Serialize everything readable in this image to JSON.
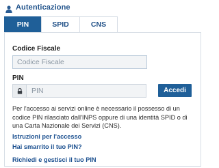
{
  "header": {
    "title": "Autenticazione",
    "icon": "user-icon"
  },
  "tabs": [
    {
      "label": "PIN",
      "active": true
    },
    {
      "label": "SPID",
      "active": false
    },
    {
      "label": "CNS",
      "active": false
    }
  ],
  "form": {
    "codice_fiscale_label": "Codice Fiscale",
    "codice_fiscale_placeholder": "Codice Fiscale",
    "pin_label": "PIN",
    "pin_placeholder": "PIN",
    "lock_icon": "lock-icon",
    "submit_label": "Accedi"
  },
  "info_text": "Per l'accesso ai servizi online è necessario il possesso di un codice PIN rilasciato dall'INPS oppure di una identità SPID o di una Carta Nazionale dei Servizi (CNS).",
  "links": [
    "Istruzioni per l'accesso",
    "Hai smarrito il tuo PIN?",
    "Richiedi e gestisci il tuo PIN"
  ],
  "colors": {
    "primary": "#1f5f98",
    "link": "#1a4f8f",
    "heading": "#22548c",
    "border": "#d6dde5"
  }
}
